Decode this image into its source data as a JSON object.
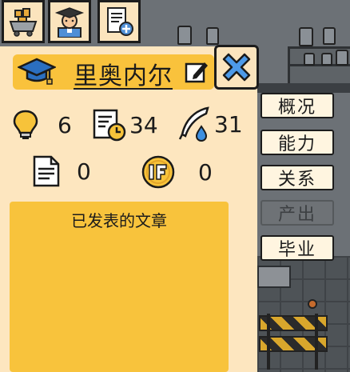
{
  "top_tabs": [
    {
      "icon": "research-cart-icon"
    },
    {
      "icon": "graduate-student-icon"
    },
    {
      "icon": "add-paper-icon"
    }
  ],
  "student": {
    "name": "里奥内尔"
  },
  "stats": {
    "ideas": "6",
    "workload": "34",
    "writing": "31",
    "papers": "0",
    "impact_factor": "0"
  },
  "papers_section": {
    "title": "已发表的文章"
  },
  "side_tabs": [
    {
      "label": "概况",
      "enabled": true
    },
    {
      "label": "能力",
      "enabled": true
    },
    {
      "label": "关系",
      "enabled": true
    },
    {
      "label": "产出",
      "enabled": false
    },
    {
      "label": "毕业",
      "enabled": true
    }
  ],
  "colors": {
    "panel_bg": "#fde6bf",
    "accent_yellow": "#f9c23c",
    "close_blue": "#4d9ae8"
  }
}
